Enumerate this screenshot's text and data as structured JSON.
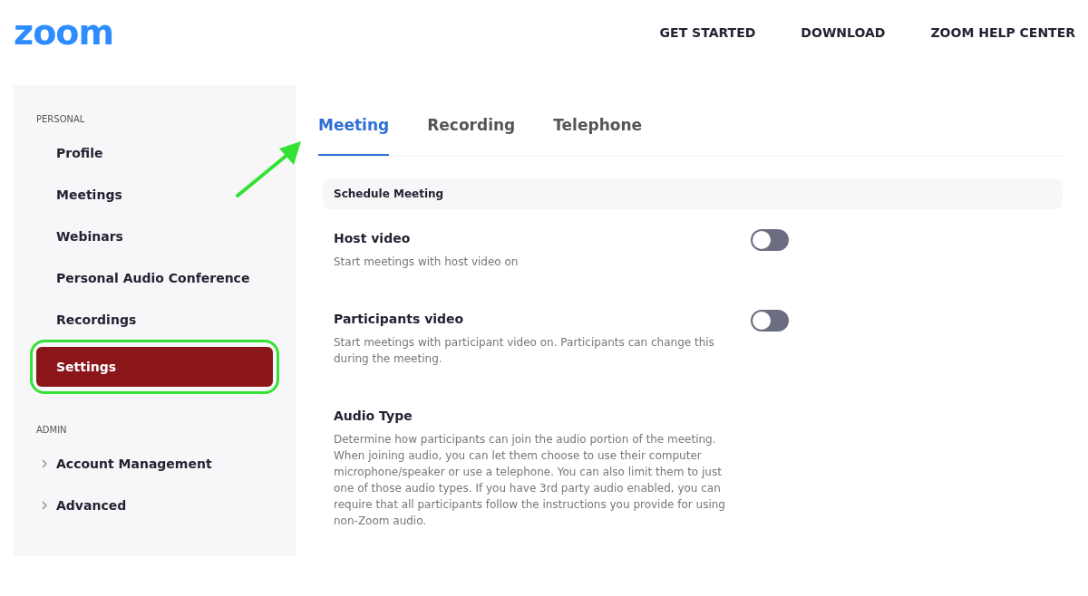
{
  "logo": "zoom",
  "top_nav": [
    "GET STARTED",
    "DOWNLOAD",
    "ZOOM HELP CENTER"
  ],
  "sidebar": {
    "sections": [
      {
        "heading": "PERSONAL",
        "items": [
          {
            "label": "Profile",
            "selected": false,
            "expandable": false,
            "annotated": false
          },
          {
            "label": "Meetings",
            "selected": false,
            "expandable": false,
            "annotated": false
          },
          {
            "label": "Webinars",
            "selected": false,
            "expandable": false,
            "annotated": false
          },
          {
            "label": "Personal Audio Conference",
            "selected": false,
            "expandable": false,
            "annotated": false
          },
          {
            "label": "Recordings",
            "selected": false,
            "expandable": false,
            "annotated": false
          },
          {
            "label": "Settings",
            "selected": true,
            "expandable": false,
            "annotated": true
          }
        ]
      },
      {
        "heading": "ADMIN",
        "items": [
          {
            "label": "Account Management",
            "selected": false,
            "expandable": true,
            "annotated": false
          },
          {
            "label": "Advanced",
            "selected": false,
            "expandable": true,
            "annotated": false
          }
        ]
      }
    ]
  },
  "tabs": [
    {
      "label": "Meeting",
      "selected": true
    },
    {
      "label": "Recording",
      "selected": false
    },
    {
      "label": "Telephone",
      "selected": false
    }
  ],
  "section_header": "Schedule Meeting",
  "settings": [
    {
      "kind": "toggle",
      "title": "Host video",
      "description": "Start meetings with host video on",
      "on": false
    },
    {
      "kind": "toggle",
      "title": "Participants video",
      "description": "Start meetings with participant video on. Participants can change this during the meeting.",
      "on": false
    },
    {
      "kind": "text",
      "title": "Audio Type",
      "description": "Determine how participants can join the audio portion of the meeting. When joining audio, you can let them choose to use their computer microphone/speaker or use a telephone. You can also limit them to just one of those audio types. If you have 3rd party audio enabled, you can require that all participants follow the instructions you provide for using non-Zoom audio."
    }
  ]
}
